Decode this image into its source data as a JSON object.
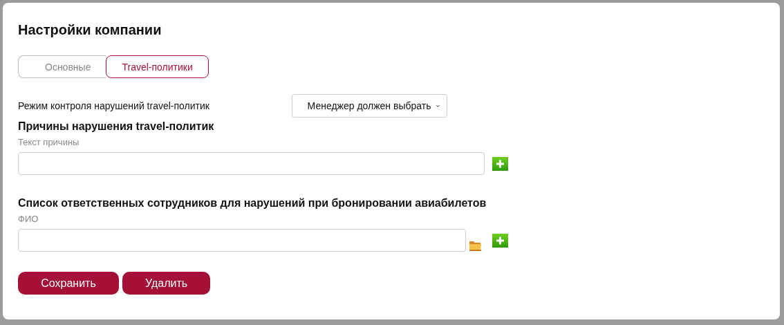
{
  "title": "Настройки компании",
  "tabs": [
    {
      "label": "Основные",
      "selected": false
    },
    {
      "label": "Travel-политики",
      "selected": true
    }
  ],
  "control_mode": {
    "label": "Режим контроля нарушений travel-политик",
    "value": "Менеджер должен выбрать"
  },
  "sections": [
    {
      "heading": "Причины нарушения travel-политик",
      "field_label": "Текст причины",
      "browse": false
    },
    {
      "heading": "Список ответственных сотрудников для нарушений при бронировании авиабилетов",
      "field_label": "ФИО",
      "browse": true
    }
  ],
  "buttons": [
    "Сохранить",
    "Удалить"
  ]
}
